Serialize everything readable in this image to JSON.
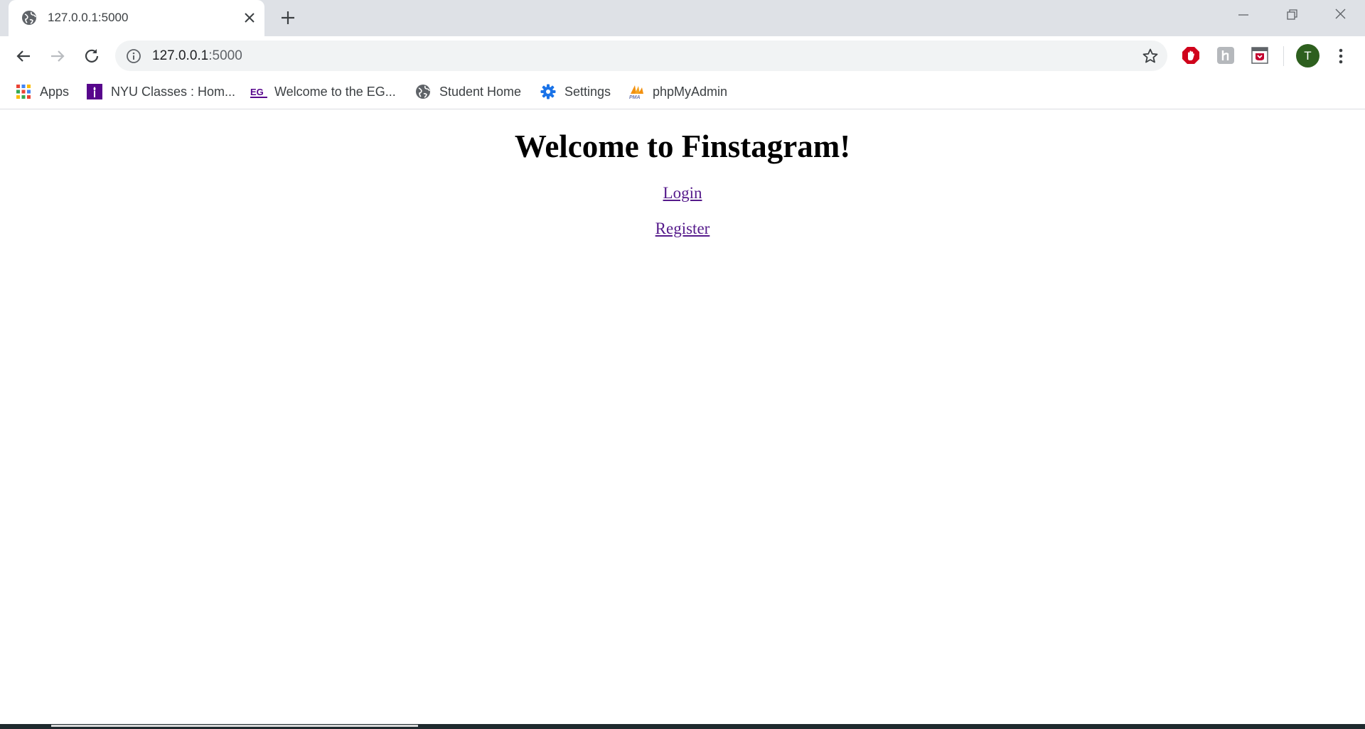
{
  "tab": {
    "title": "127.0.0.1:5000",
    "favicon": "globe-icon"
  },
  "omnibox": {
    "url_host": "127.0.0.1",
    "url_port": ":5000"
  },
  "profile": {
    "initial": "T",
    "color": "#2d5f1e"
  },
  "bookmarks": [
    {
      "label": "Apps",
      "icon": "apps-grid-icon"
    },
    {
      "label": "NYU Classes : Hom...",
      "icon": "nyu-torch-icon"
    },
    {
      "label": "Welcome to the EG...",
      "icon": "eg-logo-icon"
    },
    {
      "label": "Student Home",
      "icon": "globe-icon"
    },
    {
      "label": "Settings",
      "icon": "gear-icon"
    },
    {
      "label": "phpMyAdmin",
      "icon": "pma-logo-icon"
    }
  ],
  "page": {
    "heading": "Welcome to Finstagram!",
    "login_link": "Login",
    "register_link": "Register",
    "link_color": "#551a8b"
  }
}
